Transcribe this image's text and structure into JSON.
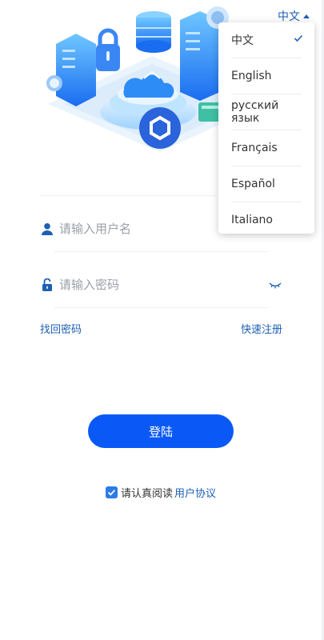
{
  "language": {
    "current": "中文",
    "options": [
      "中文",
      "English",
      "русский язык",
      "Français",
      "Español",
      "Italiano"
    ],
    "selected_index": 0
  },
  "login": {
    "username_placeholder": "请输入用户名",
    "password_placeholder": "请输入密码",
    "forgot_password": "找回密码",
    "quick_register": "快速注册",
    "submit": "登陆"
  },
  "agreement": {
    "prefix": "请认真阅读",
    "link": "用户协议",
    "checked": true
  },
  "colors": {
    "primary": "#0a59f7",
    "link": "#1d5fb4",
    "checkbox": "#2c7be5"
  },
  "icons": {
    "user": "user-icon",
    "password": "lock-icon",
    "visibility": "eye-closed-icon",
    "logo": "hexagon-logo-icon"
  }
}
